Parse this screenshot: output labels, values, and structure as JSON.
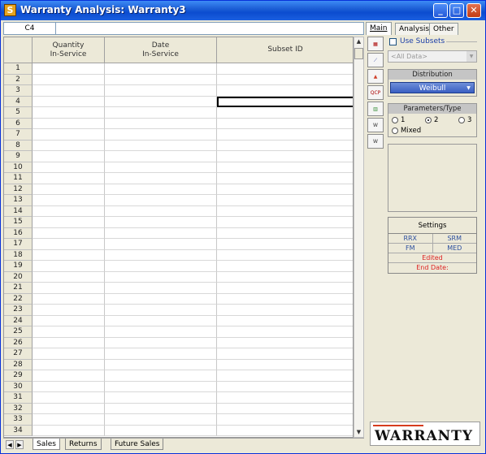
{
  "window": {
    "title": "Warranty Analysis: Warranty3",
    "icon_letter": "S"
  },
  "refbar": {
    "cell_ref": "C4"
  },
  "grid": {
    "headers": [
      "Quantity\nIn-Service",
      "Date\nIn-Service",
      "Subset ID"
    ],
    "row_numbers": [
      "1",
      "2",
      "3",
      "4",
      "5",
      "6",
      "7",
      "8",
      "9",
      "10",
      "11",
      "12",
      "13",
      "14",
      "15",
      "16",
      "17",
      "18",
      "19",
      "20",
      "21",
      "22",
      "23",
      "24",
      "25",
      "26",
      "27",
      "28",
      "29",
      "30",
      "31",
      "32",
      "33",
      "34"
    ],
    "selected": {
      "row": 4,
      "col": 3
    }
  },
  "sheet_tabs": [
    "Sales",
    "Returns",
    "Future Sales"
  ],
  "panel": {
    "tabs": [
      "Main",
      "Analysis",
      "Other"
    ],
    "use_subsets_label": "Use Subsets",
    "subset_placeholder": "<All Data>",
    "distribution_title": "Distribution",
    "distribution_value": "Weibull",
    "params_title": "Parameters/Type",
    "radio_options": [
      "1",
      "2",
      "3",
      "Mixed"
    ],
    "radio_selected": "2",
    "settings_title": "Settings",
    "settings_row1": [
      "RRX",
      "SRM"
    ],
    "settings_row2": [
      "FM",
      "MED"
    ],
    "settings_edited": "Edited",
    "settings_end_date": "End Date:",
    "logo_text": "WARRANTY"
  },
  "colors": {
    "titlebar": "#0b4ccf",
    "accent_red": "#d63c1e",
    "dist_dropdown": "#3a5fc2"
  }
}
